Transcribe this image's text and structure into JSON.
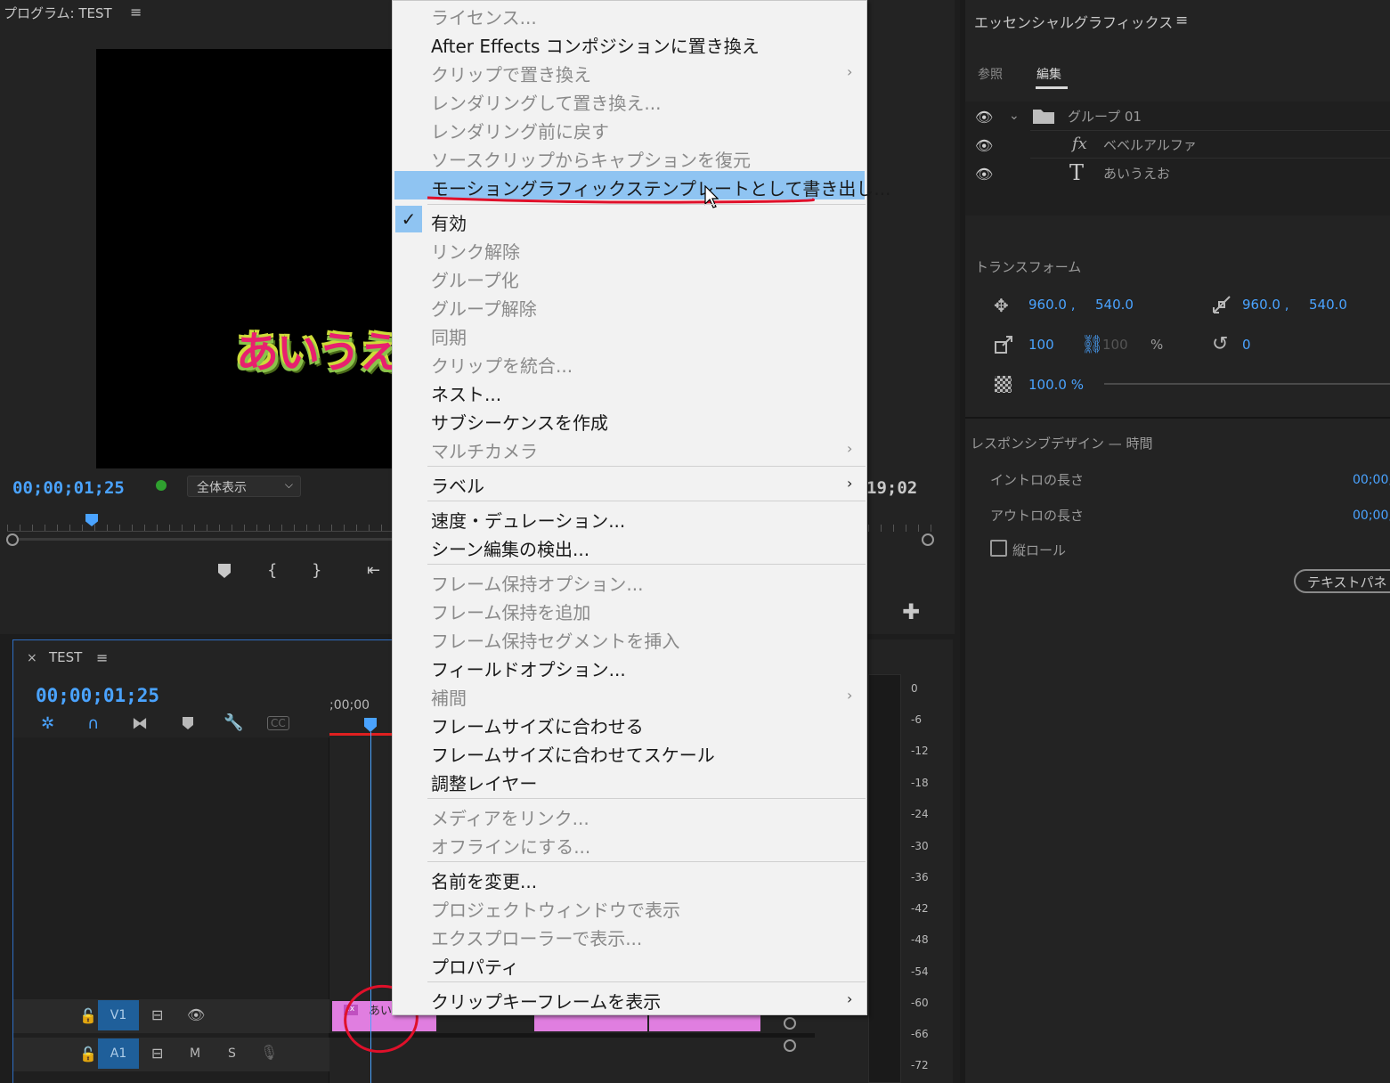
{
  "program": {
    "title": "プログラム: TEST",
    "menu_icon": "≡",
    "video_text": "あいうえ",
    "timecode": "00;00;01;25",
    "fit_option": "全体表示",
    "duration": "19;02",
    "controls": [
      "marker-icon",
      "in-point-icon",
      "out-point-icon",
      "go-to-in-icon",
      "add-icon"
    ]
  },
  "timeline": {
    "title": "TEST",
    "timecode": "00;00;01;25",
    "ruler_label": ";00;00",
    "tracks": [
      {
        "name": "V1",
        "toggle": "eye-icon"
      },
      {
        "name": "A1",
        "mute": "M",
        "solo": "S"
      }
    ],
    "clip_label": "あい",
    "clip_fx": "fx"
  },
  "meter": {
    "ticks": [
      "0",
      "-6",
      "-12",
      "-18",
      "-24",
      "-30",
      "-36",
      "-42",
      "-48",
      "-54",
      "-60",
      "-66",
      "-72"
    ]
  },
  "essential_graphics": {
    "title": "エッセンシャルグラフィックス",
    "tabs": [
      "参照",
      "編集"
    ],
    "active_tab": "編集",
    "layers": [
      {
        "name": "グループ 01",
        "icon": "folder-icon"
      },
      {
        "name": "ベベルアルファ",
        "icon": "fx-icon"
      },
      {
        "name": "あいうえお",
        "icon": "text-icon"
      }
    ],
    "transform": {
      "title": "トランスフォーム",
      "pos_x": "960.0 ,",
      "pos_y": "540.0",
      "anchor_x": "960.0 ,",
      "anchor_y": "540.0",
      "scale": "100",
      "scale_linked": "100",
      "scale_unit": "%",
      "rotation": "0",
      "opacity": "100.0 %"
    },
    "responsive": {
      "title": "レスポンシブデザイン — 時間",
      "intro_label": "イントロの長さ",
      "intro_value": "00;00;",
      "outro_label": "アウトロの長さ",
      "outro_value": "00;00;",
      "roll_label": "縦ロール",
      "text_panel_button": "テキストパネ"
    }
  },
  "context_menu": {
    "items": [
      {
        "label": "ライセンス...",
        "enabled": false
      },
      {
        "label": "After Effects コンポジションに置き換え",
        "enabled": true
      },
      {
        "label": "クリップで置き換え",
        "enabled": false,
        "submenu": true
      },
      {
        "label": "レンダリングして置き換え...",
        "enabled": false
      },
      {
        "label": "レンダリング前に戻す",
        "enabled": false
      },
      {
        "label": "ソースクリップからキャプションを復元",
        "enabled": false
      },
      {
        "label": "モーショングラフィックステンプレートとして書き出し...",
        "enabled": true,
        "highlighted": true
      },
      {
        "label": "有効",
        "enabled": true,
        "checked": true
      },
      {
        "label": "リンク解除",
        "enabled": false
      },
      {
        "label": "グループ化",
        "enabled": false
      },
      {
        "label": "グループ解除",
        "enabled": false
      },
      {
        "label": "同期",
        "enabled": false
      },
      {
        "label": "クリップを統合...",
        "enabled": false
      },
      {
        "label": "ネスト...",
        "enabled": true
      },
      {
        "label": "サブシーケンスを作成",
        "enabled": true
      },
      {
        "label": "マルチカメラ",
        "enabled": false,
        "submenu": true
      },
      {
        "label": "ラベル",
        "enabled": true,
        "submenu": true
      },
      {
        "label": "速度・デュレーション...",
        "enabled": true
      },
      {
        "label": "シーン編集の検出...",
        "enabled": true
      },
      {
        "label": "フレーム保持オプション...",
        "enabled": false
      },
      {
        "label": "フレーム保持を追加",
        "enabled": false
      },
      {
        "label": "フレーム保持セグメントを挿入",
        "enabled": false
      },
      {
        "label": "フィールドオプション...",
        "enabled": true
      },
      {
        "label": "補間",
        "enabled": false,
        "submenu": true
      },
      {
        "label": "フレームサイズに合わせる",
        "enabled": true
      },
      {
        "label": "フレームサイズに合わせてスケール",
        "enabled": true
      },
      {
        "label": "調整レイヤー",
        "enabled": true
      },
      {
        "label": "メディアをリンク...",
        "enabled": false
      },
      {
        "label": "オフラインにする...",
        "enabled": false
      },
      {
        "label": "名前を変更...",
        "enabled": true
      },
      {
        "label": "プロジェクトウィンドウで表示",
        "enabled": false
      },
      {
        "label": "エクスプローラーで表示...",
        "enabled": false
      },
      {
        "label": "プロパティ",
        "enabled": true
      },
      {
        "label": "クリップキーフレームを表示",
        "enabled": true,
        "submenu": true
      }
    ]
  },
  "colors": {
    "accent_blue": "#4aa3ff",
    "highlight": "#8fc4f2",
    "annotation_red": "#e0102a",
    "clip_pink": "#e07ee0"
  }
}
